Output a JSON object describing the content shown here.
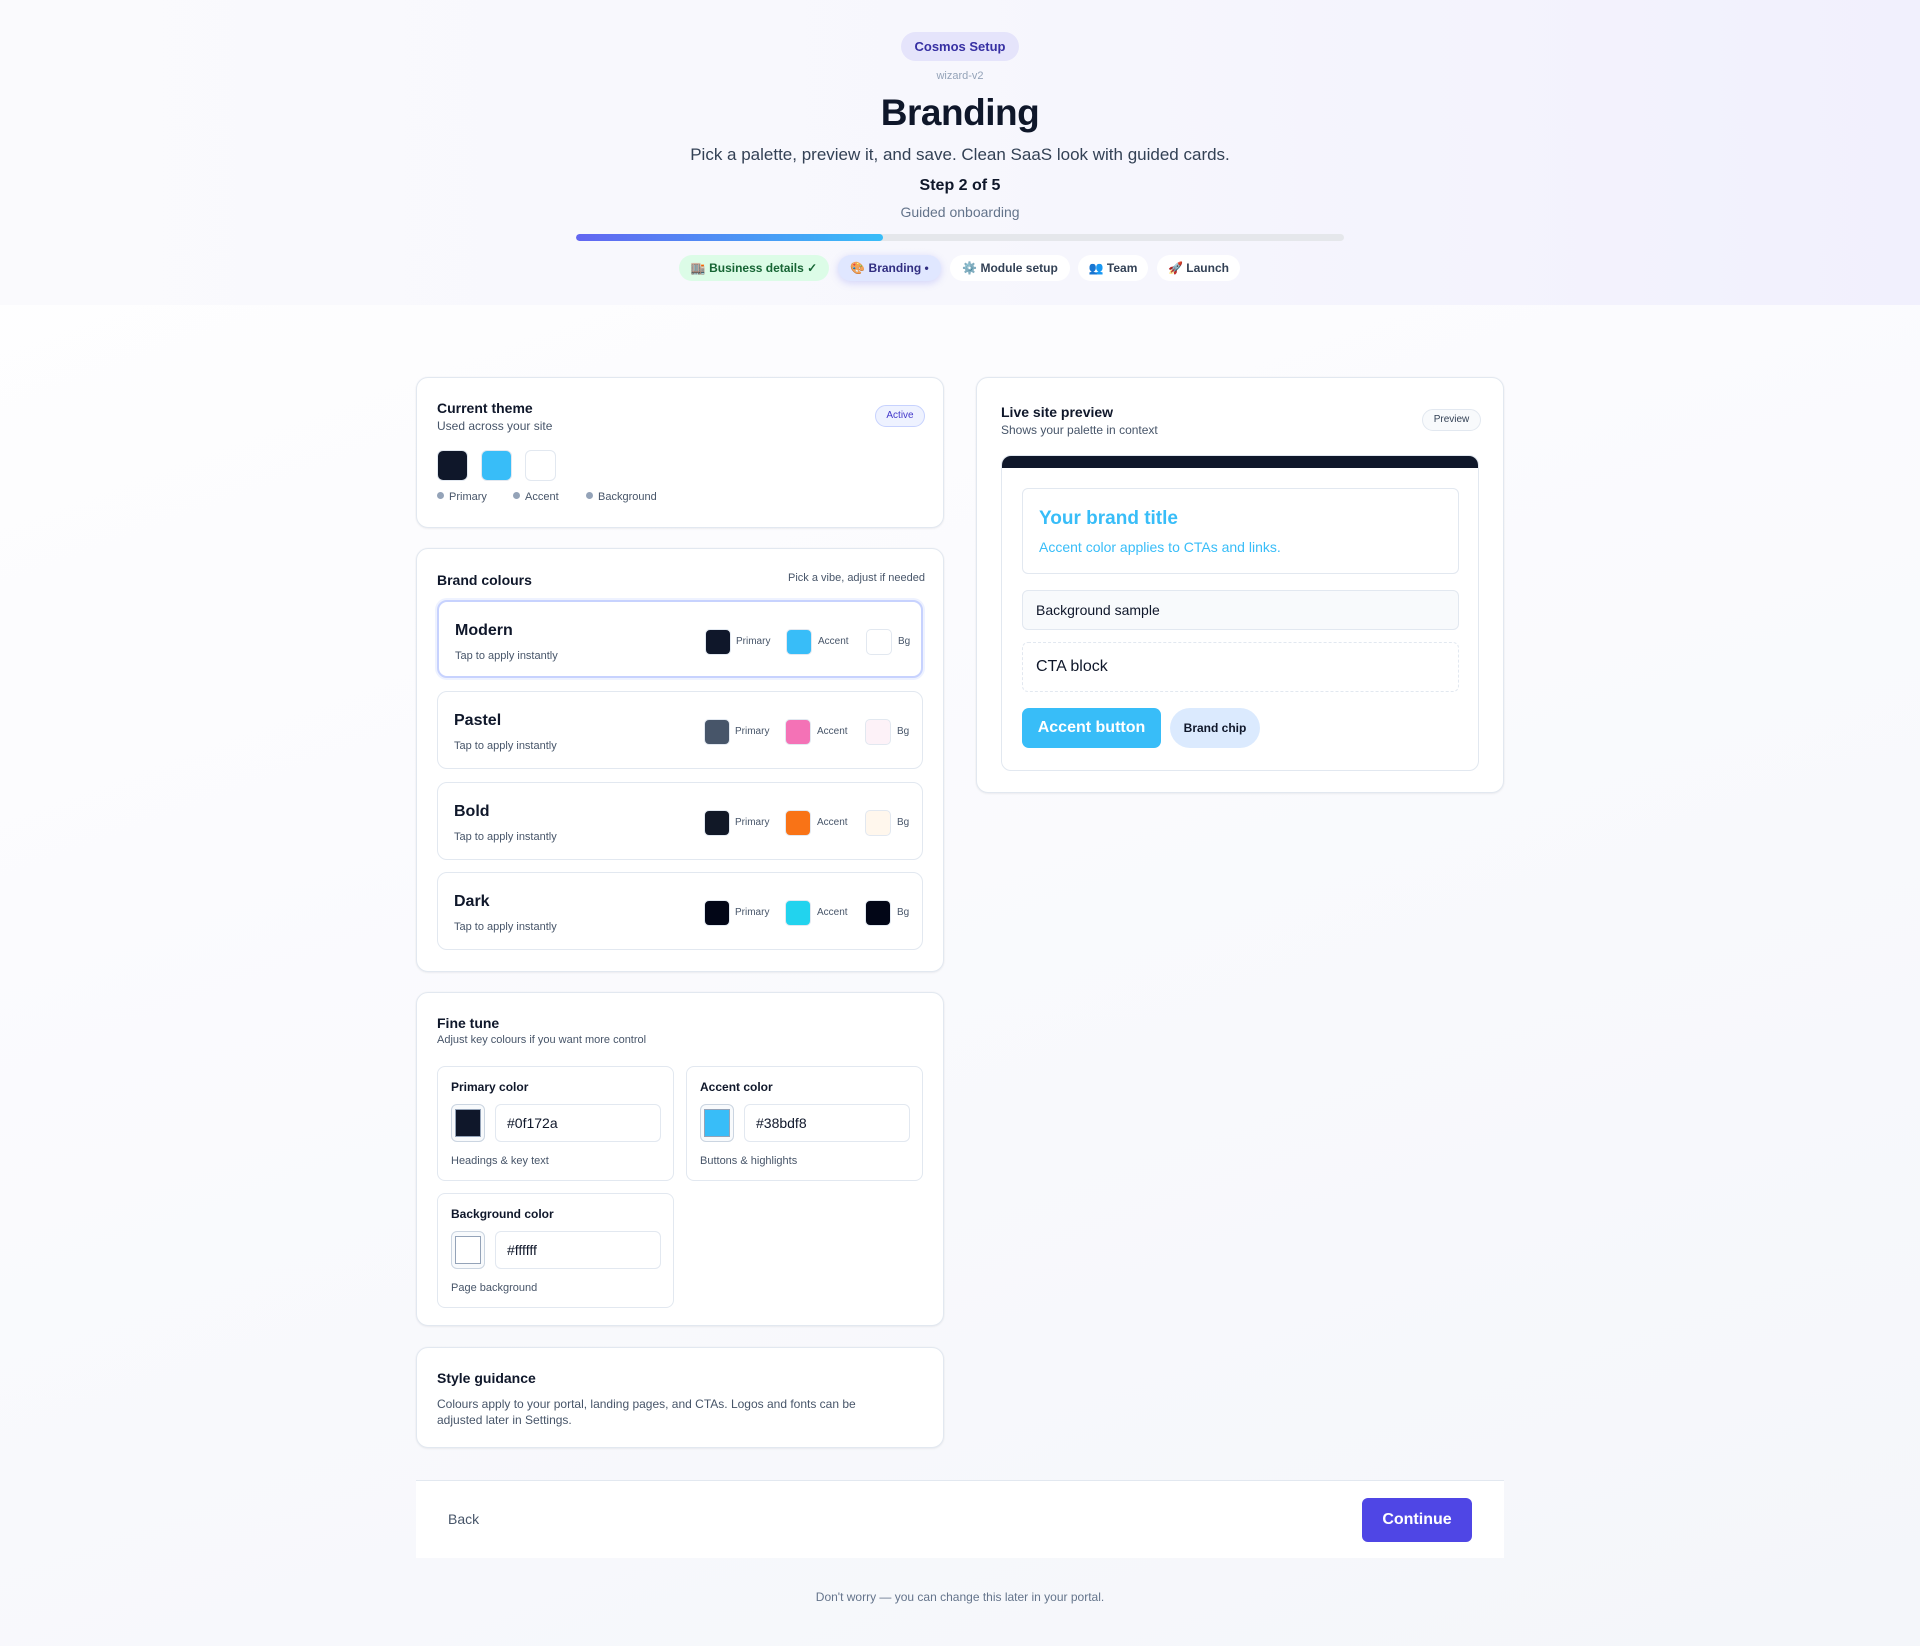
{
  "header": {
    "app_badge": "Cosmos Setup",
    "version_tag": "wizard-v2",
    "title": "Branding",
    "subtitle": "Pick a palette, preview it, and save. Clean SaaS look with guided cards.",
    "step_label": "Step 2 of 5",
    "step_sub": "Guided onboarding",
    "progress": 0.4,
    "steps": [
      {
        "label": "🏬 Business details ✓",
        "state": "done"
      },
      {
        "label": "🎨 Branding •",
        "state": "current"
      },
      {
        "label": "⚙️ Module setup",
        "state": "upcoming"
      },
      {
        "label": "👥 Team",
        "state": "upcoming"
      },
      {
        "label": "🚀 Launch",
        "state": "upcoming"
      }
    ]
  },
  "current_theme": {
    "title": "Current theme",
    "subtitle": "Used across your site",
    "badge": "Active",
    "colors": {
      "primary": "#0f172a",
      "accent": "#38bdf8",
      "background": "#ffffff"
    },
    "legend": [
      "Primary",
      "Accent",
      "Background"
    ]
  },
  "brand_colours": {
    "title": "Brand colours",
    "hint": "Pick a vibe, adjust if needed",
    "palettes": [
      {
        "name": "Modern",
        "hint": "Tap to apply instantly",
        "primary": "#0f172a",
        "accent": "#38bdf8",
        "bg": "#ffffff",
        "selected": true
      },
      {
        "name": "Pastel",
        "hint": "Tap to apply instantly",
        "primary": "#475569",
        "accent": "#f472b6",
        "bg": "#fdf2f8",
        "selected": false
      },
      {
        "name": "Bold",
        "hint": "Tap to apply instantly",
        "primary": "#111827",
        "accent": "#f97316",
        "bg": "#fff7ed",
        "selected": false
      },
      {
        "name": "Dark",
        "hint": "Tap to apply instantly",
        "primary": "#020617",
        "accent": "#22d3ee",
        "bg": "#020617",
        "selected": false
      }
    ],
    "labels": {
      "primary": "Primary",
      "accent": "Accent",
      "bg": "Bg"
    }
  },
  "fine_tune": {
    "title": "Fine tune",
    "subtitle": "Adjust key colours if you want more control",
    "fields": [
      {
        "label": "Primary color",
        "value": "#0f172a",
        "help": "Headings & key text"
      },
      {
        "label": "Accent color",
        "value": "#38bdf8",
        "help": "Buttons & highlights"
      },
      {
        "label": "Background color",
        "value": "#ffffff",
        "help": "Page background"
      }
    ]
  },
  "style_guidance": {
    "title": "Style guidance",
    "text": "Colours apply to your portal, landing pages, and CTAs. Logos and fonts can be adjusted later in Settings."
  },
  "live_preview": {
    "title": "Live site preview",
    "subtitle": "Shows your palette in context",
    "badge": "Preview",
    "brand_title": "Your brand title",
    "brand_desc": "Accent color applies to CTAs and links.",
    "background_sample": "Background sample",
    "cta_block": "CTA block",
    "accent_button": "Accent button",
    "brand_chip": "Brand chip"
  },
  "footer": {
    "back": "Back",
    "continue": "Continue",
    "note": "Don't worry — you can change this later in your portal."
  }
}
